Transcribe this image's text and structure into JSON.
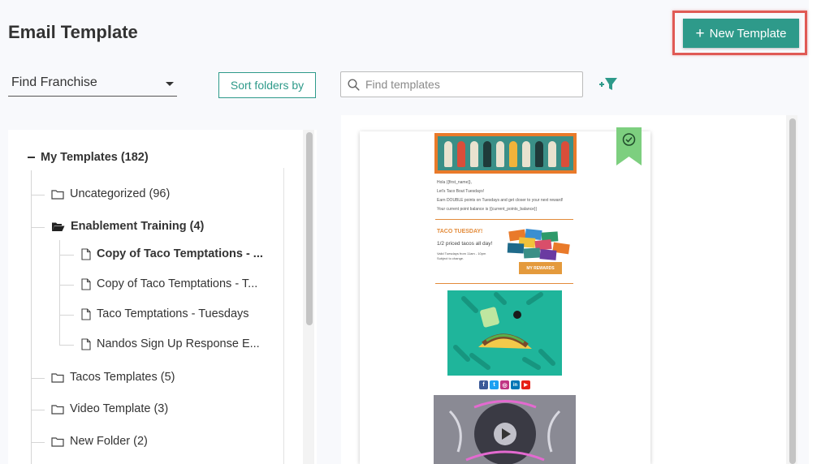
{
  "header": {
    "title": "Email Template",
    "new_template_label": "New Template",
    "new_template_icon": "plus-icon"
  },
  "toolbar": {
    "franchise_value": "Find Franchise",
    "sort_label": "Sort folders by",
    "search_placeholder": "Find templates",
    "search_icon": "search-icon",
    "filter_icon": "add-filter-icon"
  },
  "tree": {
    "root": {
      "label": "My Templates (182)",
      "expanded": true
    },
    "items": [
      {
        "label": "Uncategorized (96)",
        "type": "folder"
      },
      {
        "label": "Enablement Training (4)",
        "type": "folder-open",
        "bold": true
      },
      {
        "label": "Copy of Taco Temptations - ...",
        "type": "file",
        "bold": true,
        "selected": true
      },
      {
        "label": "Copy of Taco Temptations - T...",
        "type": "file"
      },
      {
        "label": "Taco Temptations - Tuesdays",
        "type": "file"
      },
      {
        "label": "Nandos Sign Up Response E...",
        "type": "file"
      },
      {
        "label": "Tacos Templates (5)",
        "type": "folder"
      },
      {
        "label": "Video Template (3)",
        "type": "folder"
      },
      {
        "label": "New Folder (2)",
        "type": "folder"
      }
    ]
  },
  "preview": {
    "email_lines": [
      "Hola {{first_name}},",
      "Let's Taco Bout Tuesdays!",
      "Earn DOUBLE points on Tuesdays and get closer to your next reward!",
      "Your current point balance is {{current_points_balance}}"
    ],
    "section_title": "TACO TUESDAY!",
    "section_sub": "1/2 priced tacos all day!",
    "fine_print": [
      "Valid Tuesdays from 11am - 10pm",
      "Subject to change."
    ],
    "rewards_button": "MY REWARDS",
    "ribbon_icon": "check-circle-icon",
    "social_icons": [
      "f",
      "t",
      "◎",
      "in",
      "▶"
    ]
  },
  "colors": {
    "accent": "#2e9a8a",
    "highlight": "#e05a55",
    "orange": "#e38b3a",
    "ribbon": "#7dcf7f"
  }
}
